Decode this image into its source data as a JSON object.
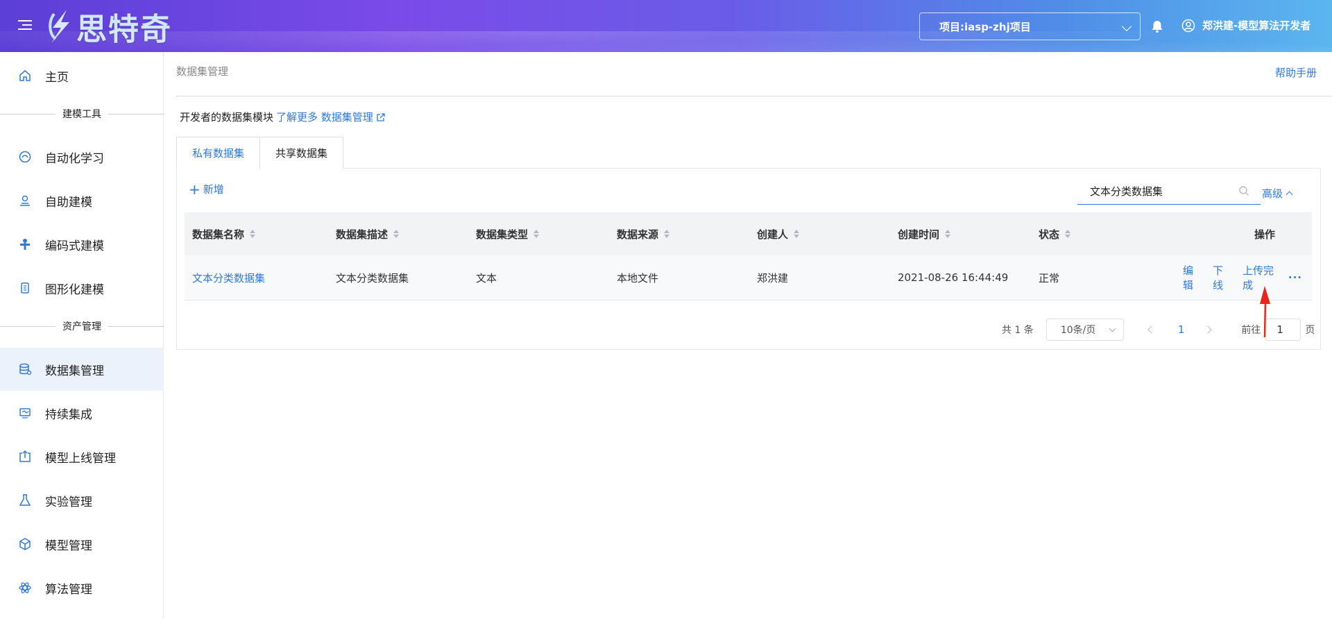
{
  "header": {
    "logo_text": "思特奇",
    "project_select": "项目:iasp-zhj项目",
    "user_name": "郑洪建-模型算法开发者"
  },
  "sidebar": {
    "home": "主页",
    "group_modeling": "建模工具",
    "items_modeling": [
      "自动化学习",
      "自助建模",
      "编码式建模",
      "图形化建模"
    ],
    "group_assets": "资产管理",
    "items_assets": [
      "数据集管理",
      "持续集成",
      "模型上线管理",
      "实验管理",
      "模型管理",
      "算法管理"
    ]
  },
  "main": {
    "breadcrumb": "数据集管理",
    "help": "帮助手册",
    "intro_text": "开发者的数据集模块",
    "intro_link": "了解更多 数据集管理",
    "tabs": [
      "私有数据集",
      "共享数据集"
    ],
    "add_label": "新增",
    "search_value": "文本分类数据集",
    "advanced_label": "高级",
    "table": {
      "columns": [
        "数据集名称",
        "数据集描述",
        "数据集类型",
        "数据来源",
        "创建人",
        "创建时间",
        "状态",
        "操作"
      ],
      "rows": [
        {
          "name": "文本分类数据集",
          "desc": "文本分类数据集",
          "type": "文本",
          "source": "本地文件",
          "creator": "郑洪建",
          "created": "2021-08-26 16:44:49",
          "status": "正常",
          "ops": [
            "编辑",
            "下线",
            "上传完成",
            "···"
          ]
        }
      ]
    },
    "pagination": {
      "total": "共 1 条",
      "page_size": "10条/页",
      "current": "1",
      "goto_label": "前往",
      "goto_value": "1",
      "page_unit": "页"
    }
  },
  "colors": {
    "accent": "#2f7ad8",
    "annotation_arrow": "#e8261c"
  }
}
